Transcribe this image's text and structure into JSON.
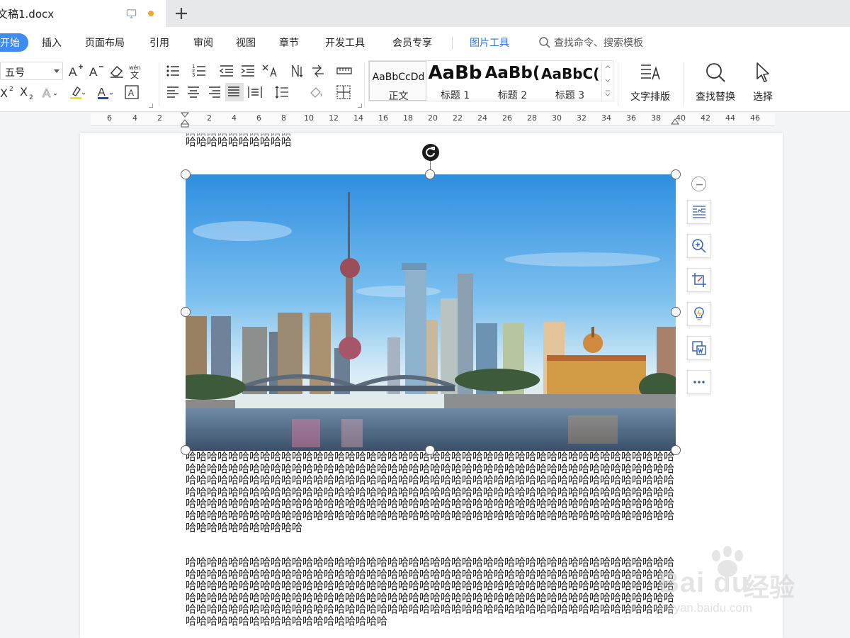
{
  "titlebar": {
    "doc_name": "文稿1.docx",
    "accent": "#f0a52b"
  },
  "menu": {
    "items": [
      "开始",
      "插入",
      "页面布局",
      "引用",
      "审阅",
      "视图",
      "章节",
      "开发工具",
      "会员专享",
      "图片工具"
    ],
    "search": "查找命令、搜索模板",
    "active_color": "#3f8cf0"
  },
  "ribbon": {
    "font_size": "五号",
    "styles": [
      {
        "sample": "AaBbCcDd",
        "label": "正文"
      },
      {
        "sample": "AaBb",
        "label": "标题 1"
      },
      {
        "sample": "AaBb(",
        "label": "标题 2"
      },
      {
        "sample": "AaBbC(",
        "label": "标题 3"
      }
    ],
    "text_layout": "文字排版",
    "find_replace": "查找替换",
    "select": "选择"
  },
  "ruler": {
    "labels": [
      "6",
      "4",
      "2",
      "2",
      "4",
      "6",
      "8",
      "10",
      "12",
      "14",
      "16",
      "18",
      "20",
      "22",
      "24",
      "26",
      "28",
      "30",
      "32",
      "34",
      "36",
      "38",
      "40",
      "42",
      "44",
      "46"
    ]
  },
  "document": {
    "top_tail": "哈哈哈哈哈哈哈哈哈哈",
    "para1": "哈哈哈哈哈哈哈哈哈哈哈哈哈哈哈哈哈哈哈哈哈哈哈哈哈哈哈哈哈哈哈哈哈哈哈哈哈哈哈哈哈哈哈哈哈哈哈哈哈哈哈哈哈哈哈哈哈哈哈哈哈哈哈哈哈哈哈哈哈哈哈哈哈哈哈哈哈哈哈哈哈哈哈哈哈哈哈哈哈哈哈哈哈哈哈哈哈哈哈哈哈哈哈哈哈哈哈哈哈哈哈哈哈哈哈哈哈哈哈哈哈哈哈哈哈哈哈哈哈哈哈哈哈哈哈哈哈哈哈哈哈哈哈哈哈哈哈哈哈哈哈哈哈哈哈哈哈哈哈哈哈哈哈哈哈哈哈哈哈哈哈哈哈哈哈哈哈哈哈哈哈哈哈哈哈哈哈哈哈哈哈哈哈哈哈哈哈哈哈哈哈哈哈哈哈哈哈哈哈哈哈哈哈哈哈哈哈哈哈哈哈哈哈哈哈哈哈哈哈哈哈哈哈哈哈哈哈哈哈哈哈哈哈哈哈哈哈哈哈哈哈哈哈哈哈哈哈哈哈哈哈哈哈哈哈哈哈哈哈哈哈哈哈哈哈哈哈哈哈哈哈哈哈哈哈哈哈",
    "para2": "哈哈哈哈哈哈哈哈哈哈哈哈哈哈哈哈哈哈哈哈哈哈哈哈哈哈哈哈哈哈哈哈哈哈哈哈哈哈哈哈哈哈哈哈哈哈哈哈哈哈哈哈哈哈哈哈哈哈哈哈哈哈哈哈哈哈哈哈哈哈哈哈哈哈哈哈哈哈哈哈哈哈哈哈哈哈哈哈哈哈哈哈哈哈哈哈哈哈哈哈哈哈哈哈哈哈哈哈哈哈哈哈哈哈哈哈哈哈哈哈哈哈哈哈哈哈哈哈哈哈哈哈哈哈哈哈哈哈哈哈哈哈哈哈哈哈哈哈哈哈哈哈哈哈哈哈哈哈哈哈哈哈哈哈哈哈哈哈哈哈哈哈哈哈哈哈哈哈哈哈哈哈哈哈哈哈哈哈哈哈哈哈哈哈哈哈哈哈哈哈哈哈哈哈哈哈哈哈哈哈哈哈哈哈哈哈哈哈哈哈哈哈哈哈哈哈哈哈哈哈哈哈哈哈哈哈哈哈哈哈哈哈哈哈哈哈哈哈哈"
  },
  "watermark": {
    "logo": "Bai du",
    "cn": "经验",
    "url": "jingyan.baidu.com"
  }
}
